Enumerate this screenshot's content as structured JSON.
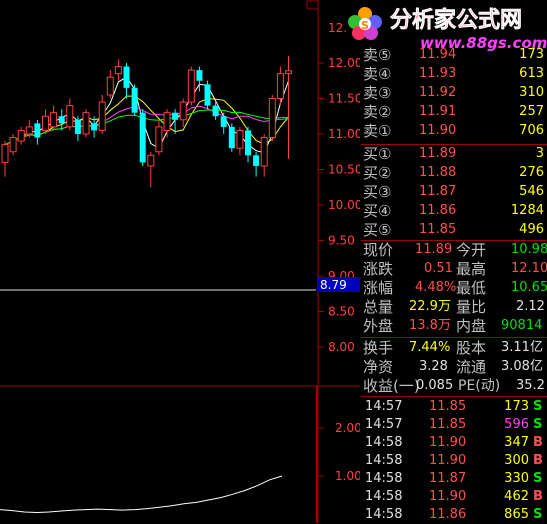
{
  "chart_data": {
    "type": "candlestick",
    "price_axis": {
      "ticks": [
        "12.00",
        "11.50",
        "11.00",
        "10.50",
        "10.00",
        "9.50",
        "9.00",
        "8.50",
        "8.00"
      ],
      "top_partial": "12."
    },
    "price_marker": "8.79",
    "volume_axis": {
      "ticks": [
        "2.00",
        "1.00"
      ]
    },
    "candles": [
      {
        "o": 10.6,
        "c": 10.85,
        "h": 10.9,
        "l": 10.4,
        "up": true
      },
      {
        "o": 10.75,
        "c": 10.95,
        "h": 11.0,
        "l": 10.7,
        "up": true
      },
      {
        "o": 10.9,
        "c": 11.05,
        "h": 11.1,
        "l": 10.85,
        "up": true
      },
      {
        "o": 11.0,
        "c": 11.1,
        "h": 11.2,
        "l": 10.95,
        "up": true
      },
      {
        "o": 11.15,
        "c": 10.95,
        "h": 11.2,
        "l": 10.85,
        "up": false
      },
      {
        "o": 11.05,
        "c": 11.25,
        "h": 11.35,
        "l": 11.0,
        "up": true
      },
      {
        "o": 11.1,
        "c": 11.3,
        "h": 11.4,
        "l": 11.05,
        "up": true
      },
      {
        "o": 11.25,
        "c": 11.15,
        "h": 11.35,
        "l": 11.05,
        "up": false
      },
      {
        "o": 11.1,
        "c": 11.4,
        "h": 11.5,
        "l": 11.05,
        "up": true
      },
      {
        "o": 11.2,
        "c": 11.0,
        "h": 11.25,
        "l": 10.9,
        "up": false
      },
      {
        "o": 11.0,
        "c": 11.3,
        "h": 11.35,
        "l": 10.95,
        "up": true
      },
      {
        "o": 11.15,
        "c": 11.05,
        "h": 11.25,
        "l": 10.95,
        "up": false
      },
      {
        "o": 11.05,
        "c": 11.45,
        "h": 11.55,
        "l": 11.0,
        "up": true
      },
      {
        "o": 11.55,
        "c": 11.8,
        "h": 11.9,
        "l": 11.5,
        "up": true
      },
      {
        "o": 11.85,
        "c": 11.95,
        "h": 12.05,
        "l": 11.75,
        "up": true
      },
      {
        "o": 11.95,
        "c": 11.65,
        "h": 12.0,
        "l": 11.5,
        "up": false
      },
      {
        "o": 11.65,
        "c": 11.3,
        "h": 11.7,
        "l": 11.25,
        "up": false
      },
      {
        "o": 11.3,
        "c": 10.6,
        "h": 11.35,
        "l": 10.55,
        "up": false
      },
      {
        "o": 10.55,
        "c": 10.7,
        "h": 10.75,
        "l": 10.25,
        "up": true
      },
      {
        "o": 10.75,
        "c": 11.1,
        "h": 11.2,
        "l": 10.7,
        "up": true
      },
      {
        "o": 11.05,
        "c": 11.3,
        "h": 11.35,
        "l": 10.95,
        "up": true
      },
      {
        "o": 11.3,
        "c": 11.2,
        "h": 11.35,
        "l": 11.0,
        "up": false
      },
      {
        "o": 11.2,
        "c": 11.45,
        "h": 11.5,
        "l": 11.1,
        "up": true
      },
      {
        "o": 11.45,
        "c": 11.9,
        "h": 11.95,
        "l": 11.4,
        "up": true
      },
      {
        "o": 11.9,
        "c": 11.75,
        "h": 11.95,
        "l": 11.6,
        "up": false
      },
      {
        "o": 11.7,
        "c": 11.4,
        "h": 11.75,
        "l": 11.35,
        "up": false
      },
      {
        "o": 11.4,
        "c": 11.25,
        "h": 11.45,
        "l": 11.2,
        "up": false
      },
      {
        "o": 11.25,
        "c": 11.1,
        "h": 11.3,
        "l": 11.0,
        "up": false
      },
      {
        "o": 11.1,
        "c": 10.8,
        "h": 11.15,
        "l": 10.75,
        "up": false
      },
      {
        "o": 10.8,
        "c": 11.05,
        "h": 11.1,
        "l": 10.7,
        "up": true
      },
      {
        "o": 11.05,
        "c": 10.7,
        "h": 11.1,
        "l": 10.6,
        "up": false
      },
      {
        "o": 10.7,
        "c": 10.55,
        "h": 10.75,
        "l": 10.4,
        "up": false
      },
      {
        "o": 10.55,
        "c": 10.95,
        "h": 11.0,
        "l": 10.4,
        "up": true
      },
      {
        "o": 10.95,
        "c": 11.5,
        "h": 11.55,
        "l": 10.9,
        "up": true
      },
      {
        "o": 11.5,
        "c": 11.85,
        "h": 11.95,
        "l": 11.4,
        "up": true
      },
      {
        "o": 11.85,
        "c": 11.89,
        "h": 12.1,
        "l": 10.65,
        "up": true
      }
    ],
    "volume_line": [
      0.3,
      0.28,
      0.25,
      0.24,
      0.25,
      0.27,
      0.29,
      0.3,
      0.31,
      0.3,
      0.29,
      0.3,
      0.32,
      0.35,
      0.38,
      0.42,
      0.45,
      0.5,
      0.55,
      0.62,
      0.7,
      0.8,
      0.92,
      1.0
    ]
  },
  "order_book": {
    "sell": [
      {
        "label": "卖⑤",
        "price": "11.94",
        "vol": "173"
      },
      {
        "label": "卖④",
        "price": "11.93",
        "vol": "613"
      },
      {
        "label": "卖③",
        "price": "11.92",
        "vol": "310"
      },
      {
        "label": "卖②",
        "price": "11.91",
        "vol": "257"
      },
      {
        "label": "卖①",
        "price": "11.90",
        "vol": "706"
      }
    ],
    "buy": [
      {
        "label": "买①",
        "price": "11.89",
        "vol": "3"
      },
      {
        "label": "买②",
        "price": "11.88",
        "vol": "276"
      },
      {
        "label": "买③",
        "price": "11.87",
        "vol": "546"
      },
      {
        "label": "买④",
        "price": "11.86",
        "vol": "1284"
      },
      {
        "label": "买⑤",
        "price": "11.85",
        "vol": "496"
      }
    ]
  },
  "quote": {
    "xianjia_l": "现价",
    "xianjia": "11.89",
    "jinkai_l": "今开",
    "jinkai": "10.98",
    "zhangdie_l": "涨跌",
    "zhangdie": "0.51",
    "zuigao_l": "最高",
    "zuigao": "12.10",
    "zhangfu_l": "涨幅",
    "zhangfu": "4.48%",
    "zuidi_l": "最低",
    "zuidi": "10.65",
    "zongliang_l": "总量",
    "zongliang": "22.9万",
    "liangbi_l": "量比",
    "liangbi": "2.12",
    "waipan_l": "外盘",
    "waipan": "13.8万",
    "neipan_l": "内盘",
    "neipan": "90814"
  },
  "fundamentals": {
    "huanshou_l": "换手",
    "huanshou": "7.44%",
    "guben_l": "股本",
    "guben": "3.11亿",
    "jingzi_l": "净资",
    "jingzi": "3.28",
    "liutong_l": "流通",
    "liutong": "3.08亿",
    "shouyi_l": "收益(一)",
    "shouyi": "0.085",
    "pe_l": "PE(动)",
    "pe": "35.2"
  },
  "ticks": [
    {
      "time": "14:57",
      "price": "11.85",
      "vol": "173",
      "bs": "S"
    },
    {
      "time": "14:57",
      "price": "11.85",
      "vol": "596",
      "bs": "S"
    },
    {
      "time": "14:58",
      "price": "11.90",
      "vol": "347",
      "bs": "B"
    },
    {
      "time": "14:58",
      "price": "11.90",
      "vol": "300",
      "bs": "B"
    },
    {
      "time": "14:58",
      "price": "11.87",
      "vol": "330",
      "bs": "S"
    },
    {
      "time": "14:58",
      "price": "11.90",
      "vol": "462",
      "bs": "B"
    },
    {
      "time": "14:58",
      "price": "11.86",
      "vol": "865",
      "bs": "S"
    }
  ],
  "watermark": {
    "title": "分析家公式网",
    "url": "www.88gs.com"
  },
  "colors": {
    "up": "#ff4040",
    "down": "#00ffff",
    "grid": "#a00000",
    "text": "#c0c0c0"
  }
}
